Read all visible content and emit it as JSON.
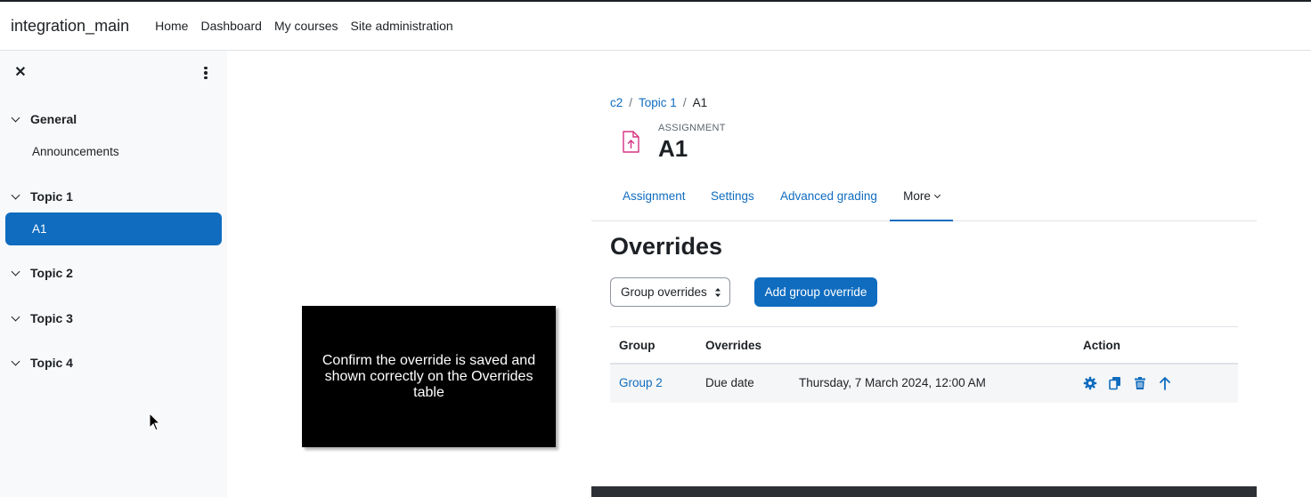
{
  "topbar": {
    "brand": "integration_main",
    "nav": [
      "Home",
      "Dashboard",
      "My courses",
      "Site administration"
    ]
  },
  "drawer": {
    "sections": [
      {
        "title": "General",
        "items": [
          "Announcements"
        ]
      },
      {
        "title": "Topic 1",
        "items": [
          "A1"
        ]
      },
      {
        "title": "Topic 2",
        "items": []
      },
      {
        "title": "Topic 3",
        "items": []
      },
      {
        "title": "Topic 4",
        "items": []
      }
    ],
    "active_item": "A1"
  },
  "tooltip": {
    "text": "Confirm the override is saved and shown correctly on the Overrides table"
  },
  "breadcrumb": [
    "c2",
    "Topic 1",
    "A1"
  ],
  "activity": {
    "type": "ASSIGNMENT",
    "title": "A1"
  },
  "tabs": [
    "Assignment",
    "Settings",
    "Advanced grading",
    "More"
  ],
  "page_title": "Overrides",
  "controls": {
    "select_value": "Group overrides",
    "add_button": "Add group override"
  },
  "table": {
    "headers": [
      "Group",
      "Overrides",
      "Action"
    ],
    "rows": [
      {
        "group": "Group 2",
        "override_label": "Due date",
        "override_value": "Thursday, 7 March 2024, 12:00 AM"
      }
    ]
  },
  "colors": {
    "primary": "#0f6cbf",
    "drawer_bg": "#f8f9fa",
    "assignment_icon": "#d63384"
  }
}
